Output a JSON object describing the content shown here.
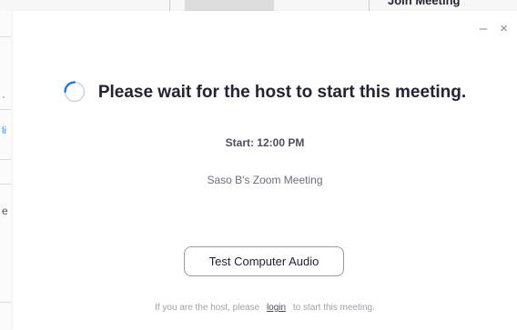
{
  "background_window": {
    "header_text": "Join Meeting",
    "left_chars": [
      "˯",
      "li",
      "e"
    ]
  },
  "dialog": {
    "minimize_label": "–",
    "close_label": "×",
    "wait_title": "Please wait for the host to start this meeting.",
    "start_time": "Start: 12:00 PM",
    "meeting_name": "Saso B's Zoom Meeting",
    "test_audio_label": "Test Computer Audio",
    "host_note_prefix": "If you are the host, please",
    "host_note_link": "login",
    "host_note_suffix": "to start this meeting.",
    "spinner_icon": "loading-spinner-icon",
    "accent_color": "#0e72ed"
  }
}
